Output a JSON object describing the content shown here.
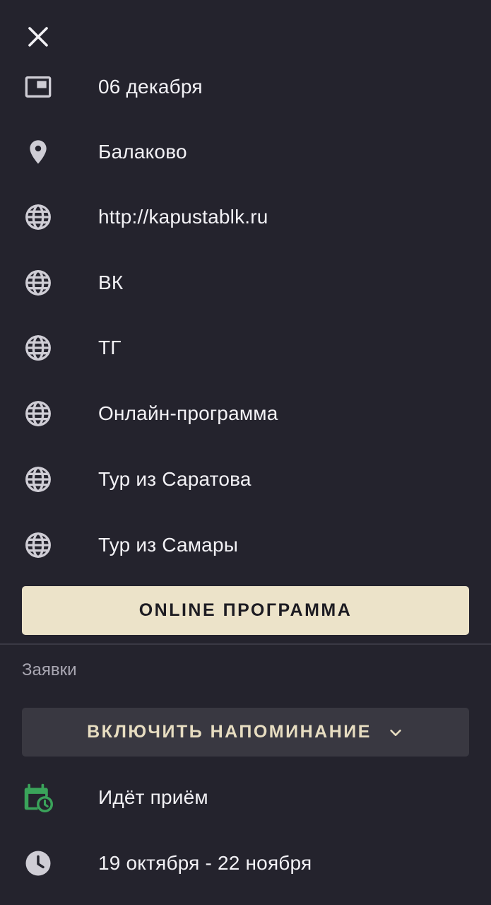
{
  "items": [
    {
      "icon": "picture-in-picture-icon",
      "label": "06 декабря"
    },
    {
      "icon": "location-pin-icon",
      "label": "Балаково"
    },
    {
      "icon": "globe-icon",
      "label": "http://kapustablk.ru"
    },
    {
      "icon": "globe-icon",
      "label": "ВК"
    },
    {
      "icon": "globe-icon",
      "label": "ТГ"
    },
    {
      "icon": "globe-icon",
      "label": "Онлайн-программа"
    },
    {
      "icon": "globe-icon",
      "label": "Тур из Саратова"
    },
    {
      "icon": "globe-icon",
      "label": "Тур из Самары"
    }
  ],
  "primary_button": {
    "label": "ONLINE ПРОГРАММА"
  },
  "applications": {
    "title": "Заявки",
    "reminder_button": {
      "label": "ВКЛЮЧИТЬ НАПОМИНАНИЕ",
      "icon": "chevron-down-icon"
    },
    "status": {
      "icon": "calendar-clock-icon",
      "label": "Идёт приём"
    },
    "dates": {
      "icon": "clock-icon",
      "label": "19 октября - 22 ноября"
    }
  },
  "colors": {
    "background": "#24232d",
    "primary_button_bg": "#ece3c9",
    "reminder_button_bg": "#393841",
    "status_icon_green": "#3aa35a",
    "icon_gray": "#cfcdd5"
  }
}
